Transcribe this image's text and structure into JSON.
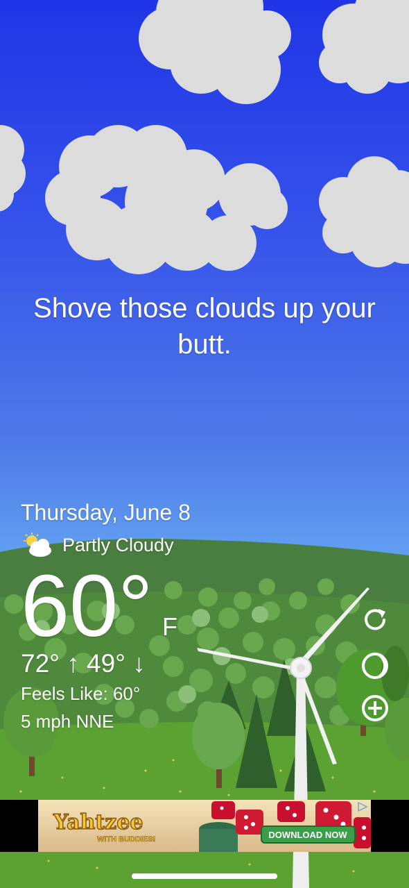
{
  "headline": "Shove those clouds up your butt.",
  "weather": {
    "date": "Thursday, June 8",
    "condition": "Partly Cloudy",
    "condition_icon": "partly-cloudy-icon",
    "temperature": "60°",
    "unit": "F",
    "high_low": "72° ↑ 49° ↓",
    "feels_like": "Feels Like: 60°",
    "wind": "5 mph NNE"
  },
  "controls": {
    "refresh_icon": "refresh-icon",
    "theme_icon": "moon-icon",
    "add_icon": "add-location-icon"
  },
  "ad": {
    "brand": "Yahtzee",
    "tagline": "WITH BUDDIES!",
    "cta": "DOWNLOAD NOW"
  },
  "colors": {
    "sky_top": "#1f35e6",
    "sky_bottom": "#6cb0f4",
    "hill": "#4c7d3c",
    "grass": "#5ba233",
    "ad_cta": "#3a9e4a"
  }
}
